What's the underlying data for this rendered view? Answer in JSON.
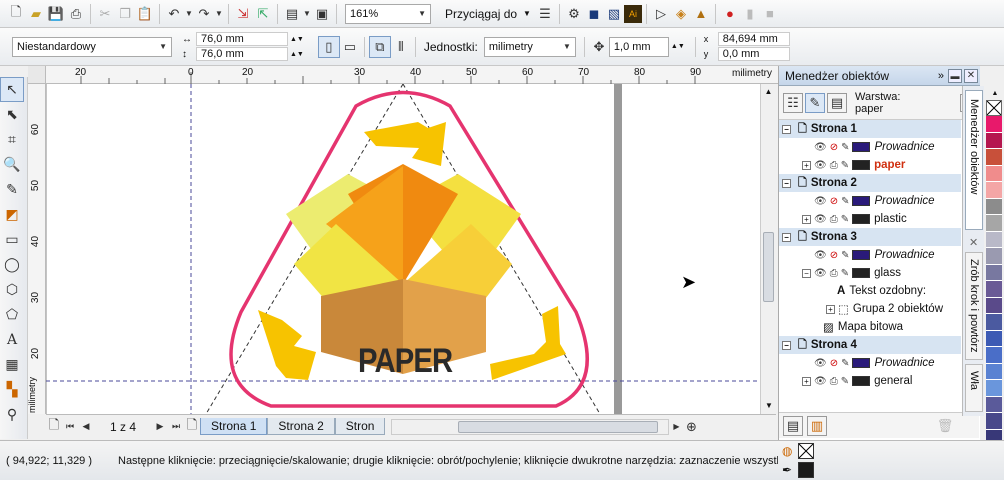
{
  "toolbar": {
    "zoom": "161%",
    "snap_label": "Przyciągaj do"
  },
  "propbar": {
    "page_preset": "Niestandardowy",
    "width": "76,0 mm",
    "height": "76,0 mm",
    "units_label": "Jednostki:",
    "units_value": "milimetry",
    "nudge": "1,0 mm",
    "dup_x": "84,694 mm",
    "dup_y": "0,0 mm"
  },
  "ruler": {
    "unit": "milimetry",
    "h_ticks": [
      "20",
      "0",
      "20",
      "30",
      "40",
      "50",
      "60",
      "70",
      "80",
      "90"
    ],
    "v_ticks": [
      "60",
      "50",
      "40",
      "30",
      "20"
    ],
    "v_unit": "milimetry"
  },
  "artwork": {
    "title": "PAPER"
  },
  "pagenav": {
    "counter": "1 z 4",
    "tabs": [
      "Strona 1",
      "Strona 2",
      "Stron"
    ]
  },
  "object_manager": {
    "title": "Menedżer obiektów",
    "layer_label": "Warstwa:",
    "layer_value": "paper",
    "rows": [
      {
        "kind": "page",
        "label": "Strona 1"
      },
      {
        "kind": "guides",
        "label": "Prowadnice",
        "color": "#2a1a7a"
      },
      {
        "kind": "layer",
        "label": "paper",
        "active": true,
        "color": "#222"
      },
      {
        "kind": "page",
        "label": "Strona 2"
      },
      {
        "kind": "guides",
        "label": "Prowadnice",
        "color": "#2a1a7a"
      },
      {
        "kind": "layer",
        "label": "plastic",
        "color": "#222"
      },
      {
        "kind": "page",
        "label": "Strona 3"
      },
      {
        "kind": "guides",
        "label": "Prowadnice",
        "color": "#2a1a7a"
      },
      {
        "kind": "layer-open",
        "label": "glass",
        "color": "#222"
      },
      {
        "kind": "object",
        "label": "Tekst ozdobny:",
        "icon": "A"
      },
      {
        "kind": "group",
        "label": "Grupa 2 obiektów"
      },
      {
        "kind": "bitmap",
        "label": "Mapa bitowa"
      },
      {
        "kind": "page",
        "label": "Strona 4"
      },
      {
        "kind": "guides",
        "label": "Prowadnice",
        "color": "#2a1a7a"
      },
      {
        "kind": "layer",
        "label": "general",
        "color": "#222"
      }
    ]
  },
  "side_tabs": [
    "Menedżer obiektów",
    "Zrób krok i powtórz",
    "Wła"
  ],
  "palette": [
    "#e8196b",
    "#b5174f",
    "#c8503a",
    "#f08c8c",
    "#f4a6a6",
    "#8c8c8c",
    "#a6a6a6",
    "#b9b9c8",
    "#9a9ab0",
    "#7878a0",
    "#6a5a96",
    "#5a4a8a",
    "#4b5aa0",
    "#3c5ab4",
    "#4a6ec8",
    "#5a82d2",
    "#6a96dc",
    "#5a5a9a",
    "#48488a",
    "#383878",
    "#2d2d6a",
    "#24245a"
  ],
  "status": {
    "coords": "( 94,922; 11,329 )",
    "message": "Następne kliknięcie: przeciągnięcie/skalowanie; drugie kliknięcie: obrót/pochylenie; kliknięcie dwukrotne narzędzia: zaznaczenie wszystki..."
  }
}
